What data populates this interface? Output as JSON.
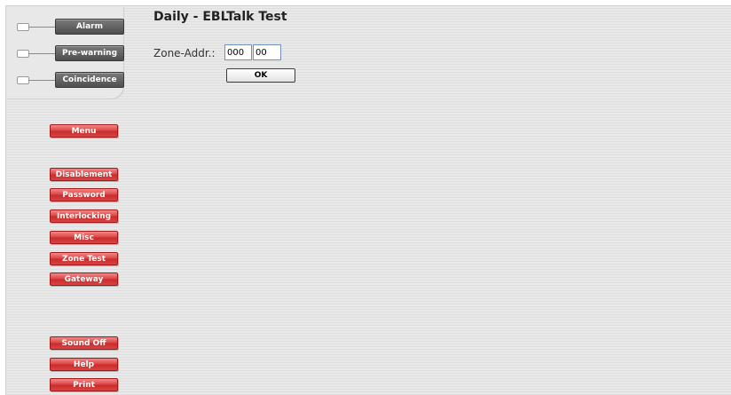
{
  "status": {
    "alarm": "Alarm",
    "prewarning": "Pre-warning",
    "coincidence": "Coincidence"
  },
  "nav": {
    "menu": "Menu",
    "disablement": "Disablement",
    "password": "Password",
    "interlocking": "Interlocking",
    "misc": "Misc",
    "zone_test": "Zone Test",
    "gateway": "Gateway",
    "sound_off": "Sound Off",
    "help": "Help",
    "print": "Print"
  },
  "main": {
    "title": "Daily - EBLTalk Test",
    "zone_label": "Zone-Addr.:",
    "zone_value": "000",
    "addr_value": "00",
    "ok_label": "OK"
  },
  "colors": {
    "nav_button": "#d84545",
    "status_button": "#5e5e5e",
    "background": "#e6e6e6"
  }
}
